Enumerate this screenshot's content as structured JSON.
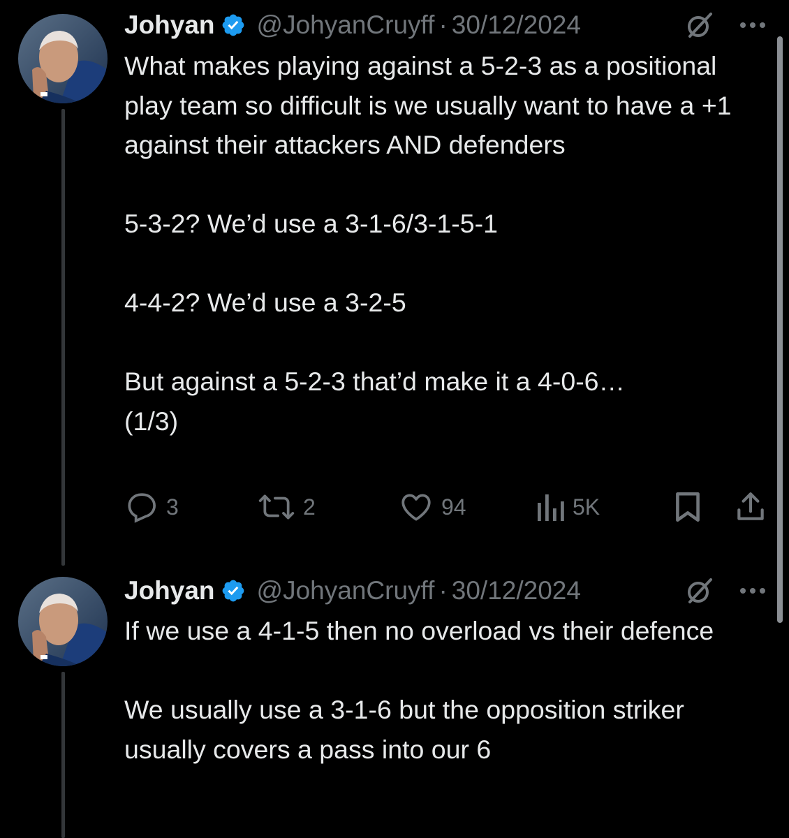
{
  "tweets": [
    {
      "author_name": "Johyan",
      "handle": "@JohyanCruyff",
      "separator": "·",
      "date": "30/12/2024",
      "paragraphs": [
        "What makes playing against a 5-2-3 as a positional play team so difficult is we usually want to have a +1 against their attackers AND defenders",
        "5-3-2? We’d use a 3-1-6/3-1-5-1",
        "4-4-2? We’d use a 3-2-5",
        "But against a 5-2-3 that’d make it a 4-0-6…\n(1/3)"
      ],
      "actions": {
        "replies": "3",
        "reposts": "2",
        "likes": "94",
        "views": "5K"
      }
    },
    {
      "author_name": "Johyan",
      "handle": "@JohyanCruyff",
      "separator": "·",
      "date": "30/12/2024",
      "paragraphs": [
        "If we use a 4-1-5 then no overload vs their defence",
        "We usually use a 3-1-6 but the opposition striker usually covers a pass into our 6"
      ]
    }
  ],
  "icons": {
    "verified": "verified-badge-icon",
    "grok": "grok-icon",
    "more": "more-options-icon",
    "reply": "reply-icon",
    "repost": "repost-icon",
    "like": "like-icon",
    "views": "views-icon",
    "bookmark": "bookmark-icon",
    "share": "share-icon"
  },
  "colors": {
    "background": "#000000",
    "text_primary": "#e7e9ea",
    "text_secondary": "#71767b",
    "verified_blue": "#1d9bf0",
    "thread_line": "#333639"
  }
}
